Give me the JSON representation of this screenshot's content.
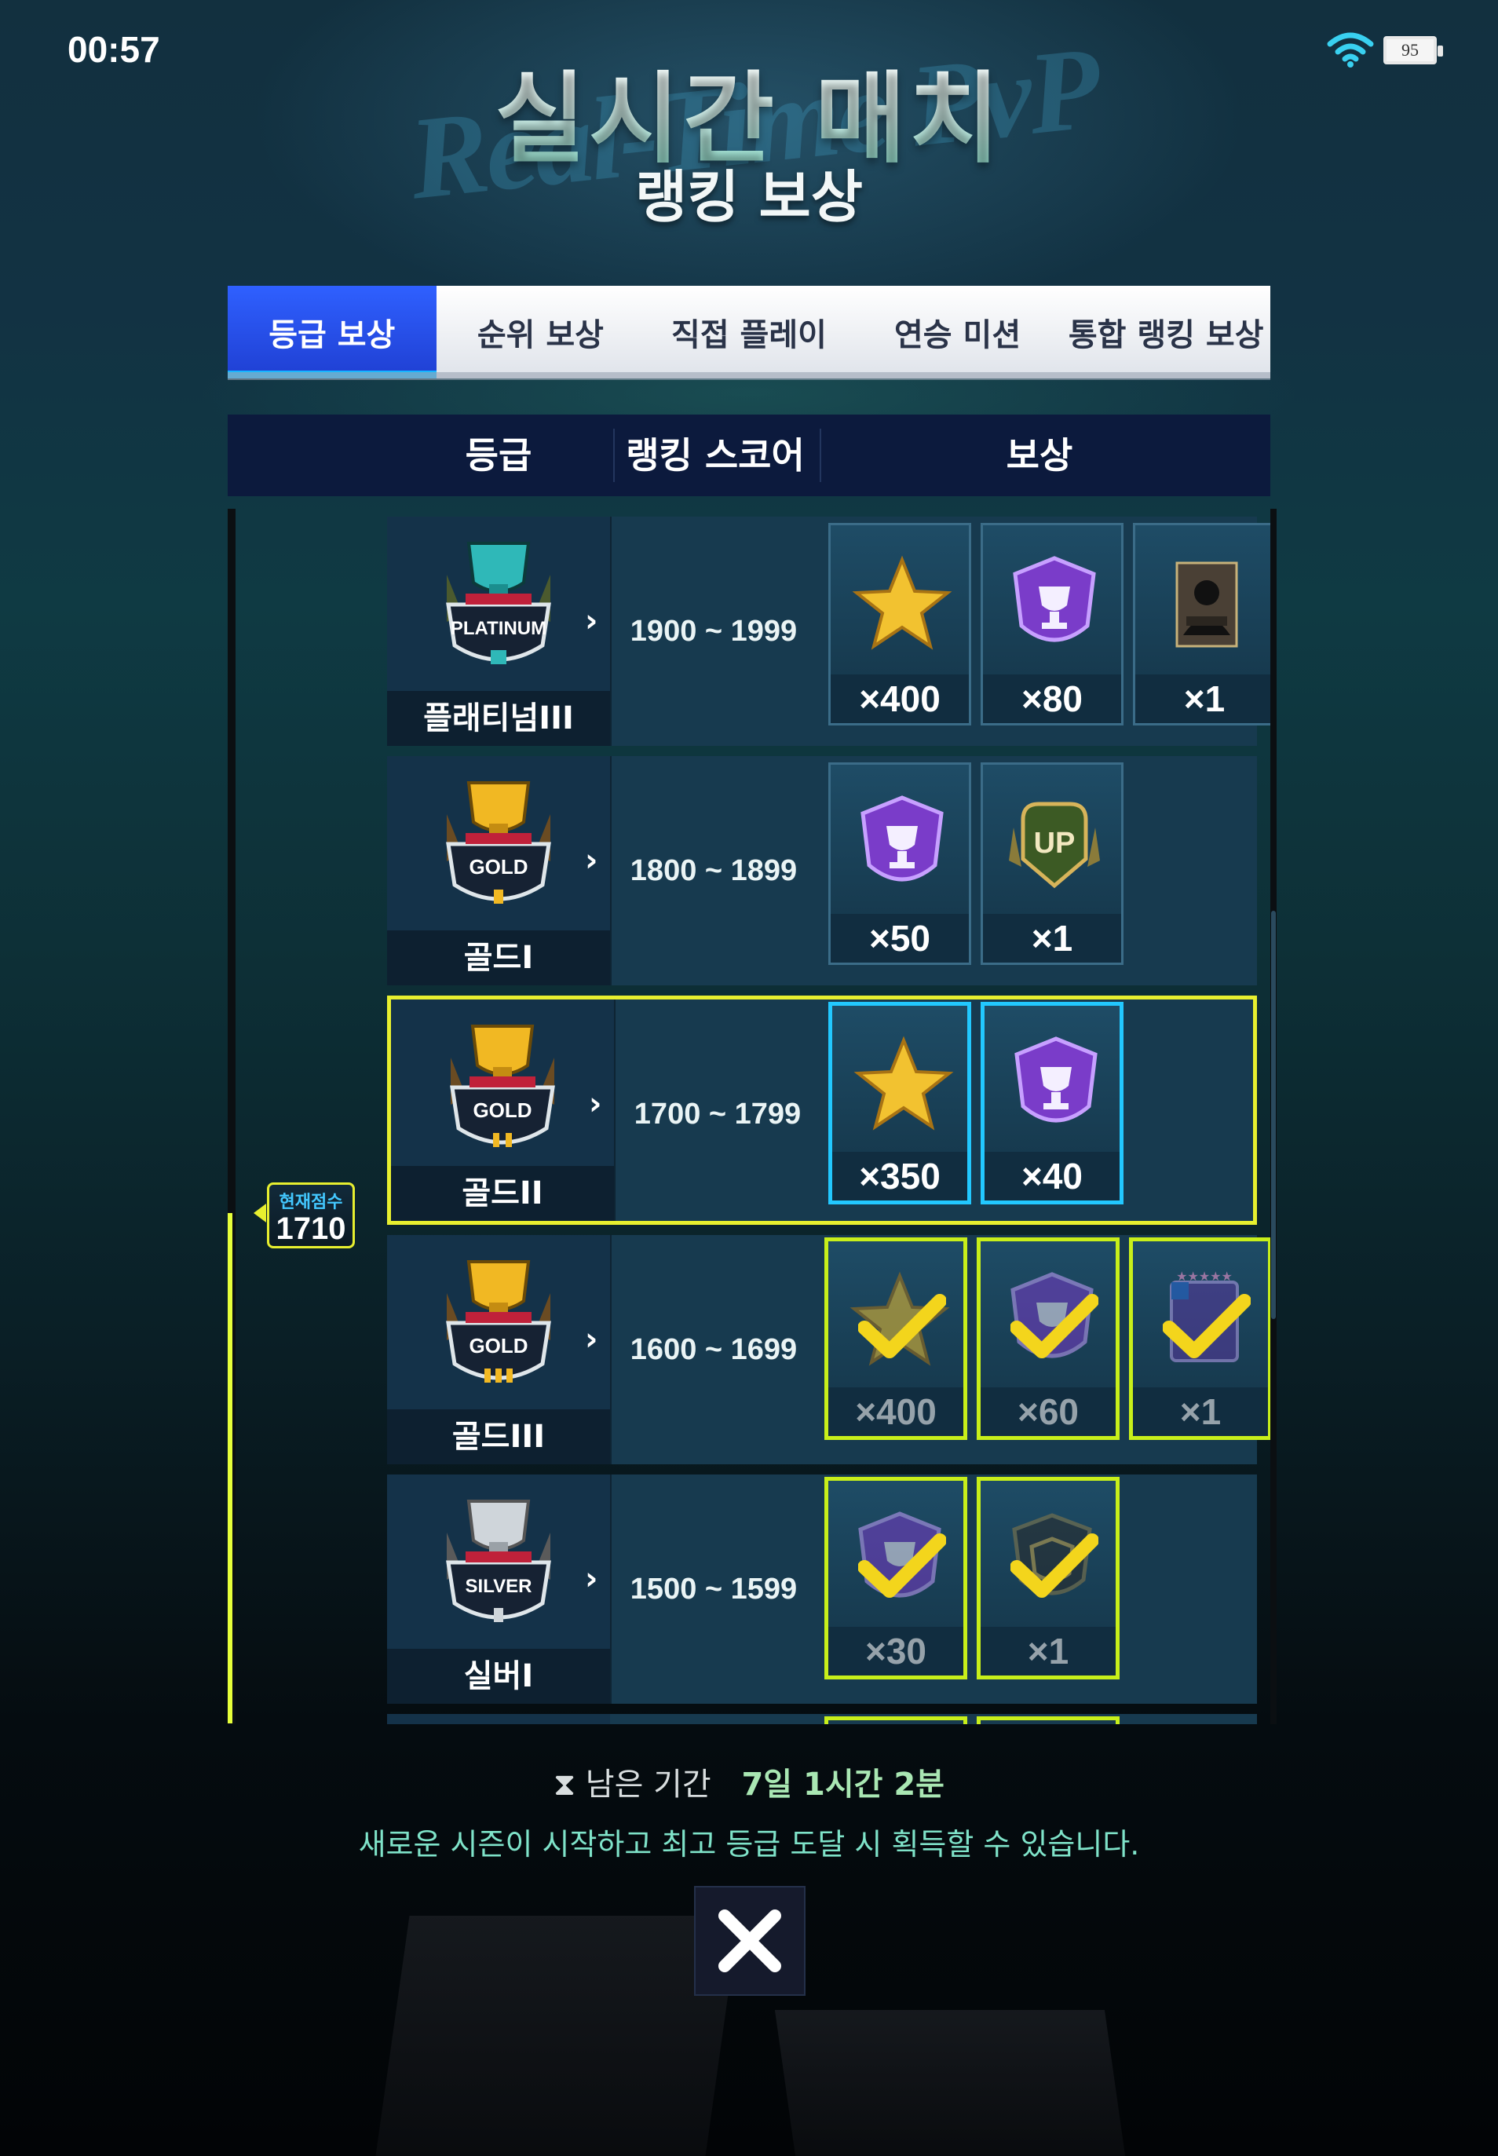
{
  "status_bar": {
    "time": "00:57",
    "battery": "95"
  },
  "title": {
    "bg_text": "Real-Time PvP",
    "main": "실시간 매치",
    "sub": "랭킹 보상"
  },
  "tabs": [
    {
      "label": "등급 보상",
      "active": true
    },
    {
      "label": "순위 보상",
      "active": false
    },
    {
      "label": "직접 플레이",
      "active": false
    },
    {
      "label": "연승 미션",
      "active": false
    },
    {
      "label": "통합 랭킹 보상",
      "active": false
    }
  ],
  "table_header": {
    "grade": "등급",
    "score": "랭킹 스코어",
    "reward": "보상"
  },
  "rows": [
    {
      "grade": "플래티넘III",
      "emblem_text": "PLATINUM",
      "score_range": "1900 ~ 1999",
      "state": "locked",
      "rewards": [
        {
          "icon": "star-icon",
          "qty": "×400"
        },
        {
          "icon": "trophy-shield-icon",
          "qty": "×80"
        },
        {
          "icon": "enhance-card-icon",
          "qty": "×1"
        }
      ]
    },
    {
      "grade": "골드I",
      "emblem_text": "GOLD",
      "score_range": "1800 ~ 1899",
      "state": "locked",
      "rewards": [
        {
          "icon": "trophy-shield-icon",
          "qty": "×50"
        },
        {
          "icon": "up-badge-icon",
          "qty": "×1"
        }
      ]
    },
    {
      "grade": "골드II",
      "emblem_text": "GOLD",
      "score_range": "1700 ~ 1799",
      "state": "current",
      "rewards": [
        {
          "icon": "star-icon",
          "qty": "×350"
        },
        {
          "icon": "trophy-shield-icon",
          "qty": "×40"
        }
      ]
    },
    {
      "grade": "골드III",
      "emblem_text": "GOLD",
      "score_range": "1600 ~ 1699",
      "state": "claimed",
      "rewards": [
        {
          "icon": "star-icon",
          "qty": "×400"
        },
        {
          "icon": "trophy-shield-icon",
          "qty": "×60"
        },
        {
          "icon": "player-card-icon",
          "qty": "×1"
        }
      ]
    },
    {
      "grade": "실버I",
      "emblem_text": "SILVER",
      "score_range": "1500 ~ 1599",
      "state": "claimed",
      "rewards": [
        {
          "icon": "trophy-shield-icon",
          "qty": "×30"
        },
        {
          "icon": "dark-shield-icon",
          "qty": "×1"
        }
      ]
    }
  ],
  "score_marker": {
    "label": "현재점수",
    "value": "1710"
  },
  "remaining": {
    "label": "남은 기간",
    "value": "7일 1시간 2분"
  },
  "notice": "새로운 시즌이 시작하고 최고 등급 도달 시 획득할 수 있습니다.",
  "colors": {
    "tab_active": "#2448e0",
    "current_border": "#e7ef2f",
    "claimed_border": "#c8ef1a",
    "current_reward_border": "#22c8ff"
  }
}
